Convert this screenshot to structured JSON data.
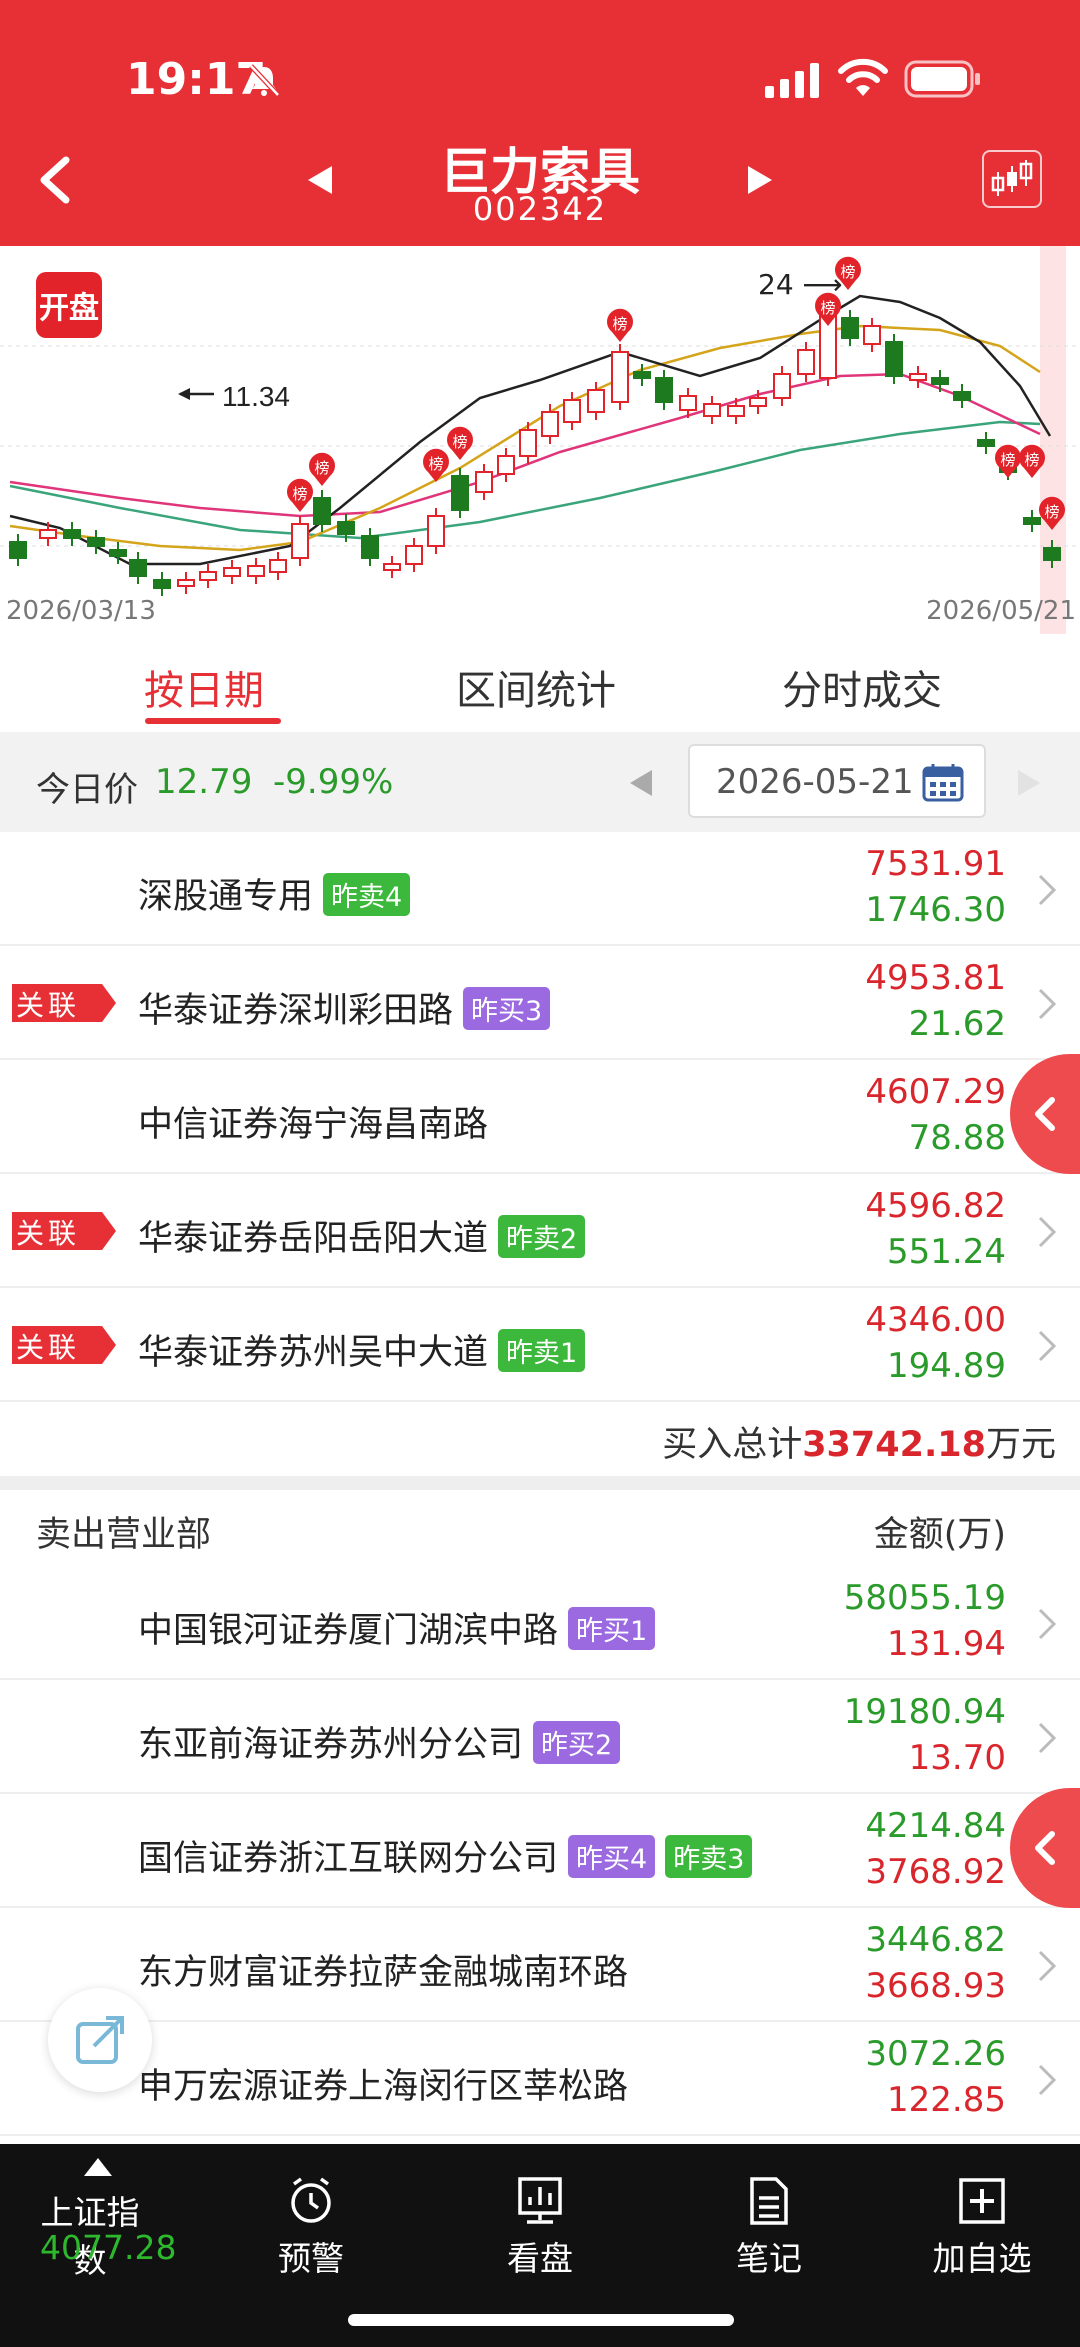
{
  "status_bar": {
    "time": "19:17"
  },
  "header": {
    "stock_name": "巨力索具",
    "stock_code": "002342"
  },
  "chart": {
    "badge": "开盘",
    "date_start": "2026/03/13",
    "date_end": "2026/05/21",
    "low_label": "11.34",
    "high_label": "24",
    "marker_label": "榜"
  },
  "tabs": [
    "按日期",
    "区间统计",
    "分时成交"
  ],
  "price_bar": {
    "label": "今日价",
    "price": "12.79",
    "change": "-9.99%",
    "date": "2026-05-21"
  },
  "buy_rows": [
    {
      "name": "深股通专用",
      "tags": [
        {
          "text": "昨卖4",
          "color": "green"
        }
      ],
      "v1": "7531.91",
      "v2": "1746.30",
      "related": false
    },
    {
      "name": "华泰证券深圳彩田路",
      "tags": [
        {
          "text": "昨买3",
          "color": "purple"
        }
      ],
      "v1": "4953.81",
      "v2": "21.62",
      "related": true
    },
    {
      "name": "中信证券海宁海昌南路",
      "tags": [],
      "v1": "4607.29",
      "v2": "78.88",
      "related": false
    },
    {
      "name": "华泰证券岳阳岳阳大道",
      "tags": [
        {
          "text": "昨卖2",
          "color": "green"
        }
      ],
      "v1": "4596.82",
      "v2": "551.24",
      "related": true
    },
    {
      "name": "华泰证券苏州吴中大道",
      "tags": [
        {
          "text": "昨卖1",
          "color": "green"
        }
      ],
      "v1": "4346.00",
      "v2": "194.89",
      "related": true
    }
  ],
  "related_label": "关联",
  "buy_total": {
    "prefix": "买入总计",
    "amount": "33742.18",
    "unit": "万元"
  },
  "sell_header": {
    "title": "卖出营业部",
    "amount_col": "金额(万)"
  },
  "sell_rows": [
    {
      "name": "中国银河证券厦门湖滨中路",
      "tags": [
        {
          "text": "昨买1",
          "color": "purple"
        }
      ],
      "v1": "58055.19",
      "v2": "131.94"
    },
    {
      "name": "东亚前海证券苏州分公司",
      "tags": [
        {
          "text": "昨买2",
          "color": "purple"
        }
      ],
      "v1": "19180.94",
      "v2": "13.70"
    },
    {
      "name": "国信证券浙江互联网分公司",
      "tags": [
        {
          "text": "昨买4",
          "color": "purple"
        },
        {
          "text": "昨卖3",
          "color": "green"
        }
      ],
      "v1": "4214.84",
      "v2": "3768.92"
    },
    {
      "name": "东方财富证券拉萨金融城南环路",
      "tags": [],
      "v1": "3446.82",
      "v2": "3668.93"
    },
    {
      "name": "申万宏源证券上海闵行区莘松路",
      "tags": [],
      "v1": "3072.26",
      "v2": "122.85"
    }
  ],
  "bottom_nav": {
    "index_name": "上证指数",
    "index_value": "4077.28",
    "items": [
      "预警",
      "看盘",
      "笔记",
      "加自选"
    ]
  },
  "colors": {
    "brand_red": "#e63036",
    "up_red": "#d9262c",
    "down_green": "#2a9b2a",
    "tag_green": "#3cb83c",
    "tag_purple": "#9b6ae0"
  }
}
